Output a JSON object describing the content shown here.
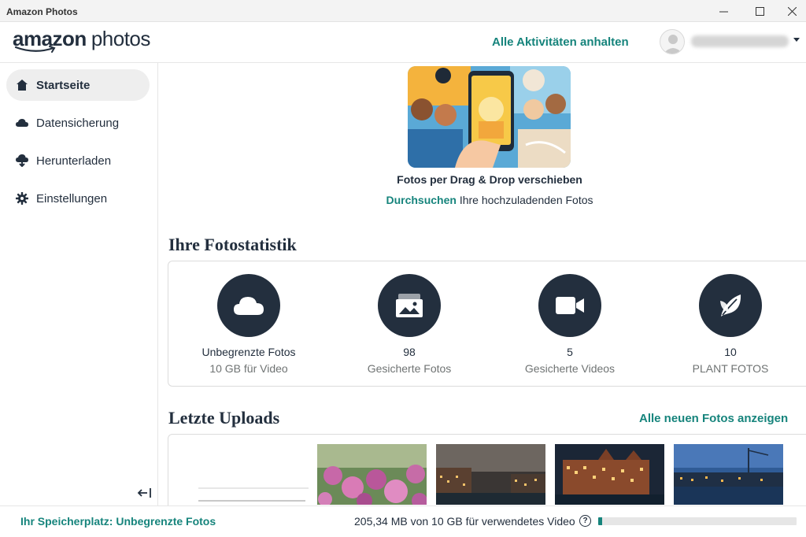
{
  "window": {
    "title": "Amazon Photos"
  },
  "header": {
    "logo_brand": "amazon",
    "logo_product": "photos",
    "pause_all_label": "Alle Aktivitäten anhalten"
  },
  "sidebar": {
    "items": [
      {
        "label": "Startseite",
        "icon": "home-icon",
        "active": true
      },
      {
        "label": "Datensicherung",
        "icon": "cloud-icon",
        "active": false
      },
      {
        "label": "Herunterladen",
        "icon": "cloud-download-icon",
        "active": false
      },
      {
        "label": "Einstellungen",
        "icon": "gear-icon",
        "active": false
      }
    ]
  },
  "dropzone": {
    "title": "Fotos per Drag & Drop verschieben",
    "browse_label": "Durchsuchen",
    "browse_suffix": " Ihre hochzuladenden Fotos"
  },
  "stats": {
    "title": "Ihre Fotostatistik",
    "items": [
      {
        "value": "Unbegrenzte Fotos",
        "label": "10 GB für Video",
        "icon": "cloud-icon"
      },
      {
        "value": "98",
        "label": "Gesicherte Fotos",
        "icon": "photos-icon"
      },
      {
        "value": "5",
        "label": "Gesicherte Videos",
        "icon": "video-camera-icon"
      },
      {
        "value": "10",
        "label": "PLANT FOTOS",
        "icon": "leaf-icon"
      }
    ]
  },
  "uploads": {
    "title": "Letzte Uploads",
    "all_link": "Alle neuen Fotos anzeigen"
  },
  "footer": {
    "storage_label": "Ihr Speicherplatz: Unbegrenzte Fotos",
    "usage_text": "205,34 MB von 10 GB für verwendetes Video",
    "usage_fraction": 0.02,
    "accent_color": "#16847c"
  },
  "colors": {
    "accent": "#16847c",
    "dark": "#232f3e"
  }
}
